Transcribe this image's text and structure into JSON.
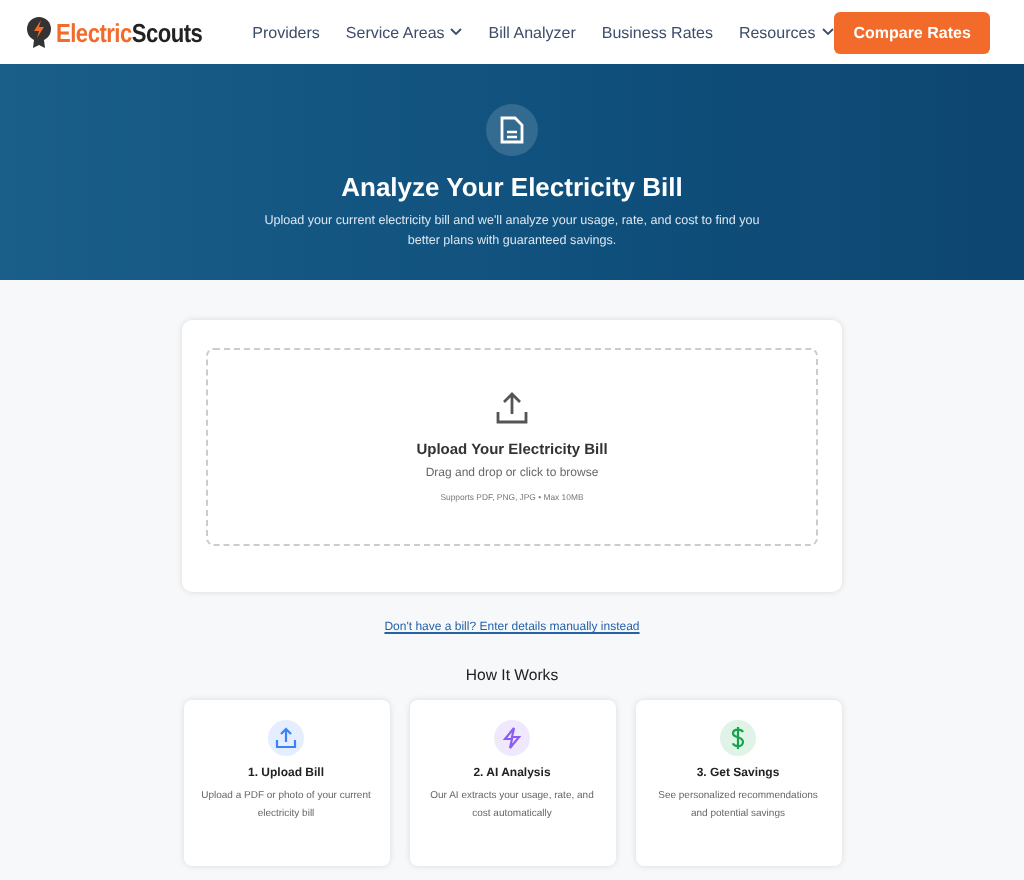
{
  "header": {
    "logo_first": "Electric",
    "logo_second": "Scouts",
    "nav": [
      {
        "label": "Providers",
        "dropdown": false
      },
      {
        "label": "Service Areas",
        "dropdown": true
      },
      {
        "label": "Bill Analyzer",
        "dropdown": false
      },
      {
        "label": "Business Rates",
        "dropdown": false
      },
      {
        "label": "Resources",
        "dropdown": true
      }
    ],
    "cta": "Compare Rates"
  },
  "hero": {
    "title": "Analyze Your Electricity Bill",
    "subtitle": "Upload your current electricity bill and we'll analyze your usage, rate, and cost to find you better plans with guaranteed savings."
  },
  "upload": {
    "title": "Upload Your Electricity Bill",
    "hint": "Drag and drop or click to browse",
    "formats": "Supports PDF, PNG, JPG • Max 10MB"
  },
  "manual_link": "Don't have a bill? Enter details manually instead",
  "how_it_works": {
    "title": "How It Works",
    "steps": [
      {
        "kind": "upload",
        "color": "#3b82f6",
        "title": "1. Upload Bill",
        "text": "Upload a PDF or photo of your current electricity bill"
      },
      {
        "kind": "bolt",
        "color": "#8b5cf6",
        "title": "2. AI Analysis",
        "text": "Our AI extracts your usage, rate, and cost automatically"
      },
      {
        "kind": "dollar",
        "color": "#16a34a",
        "title": "3. Get Savings",
        "text": "See personalized recommendations and potential savings"
      }
    ]
  }
}
